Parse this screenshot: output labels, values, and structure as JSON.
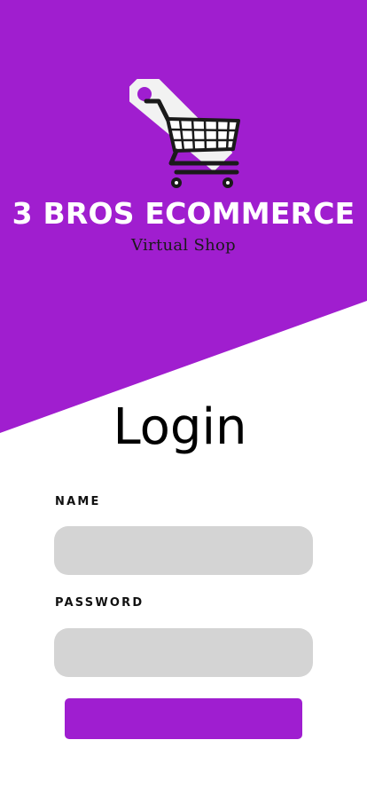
{
  "brand": {
    "title": "3 BROS ECOMMERCE",
    "subtitle": "Virtual Shop",
    "logo_icon": "shopping-cart-tag-icon"
  },
  "login": {
    "title": "Login",
    "name_label": "NAME",
    "name_value": "",
    "name_placeholder": "",
    "password_label": "PASSWORD",
    "password_value": "",
    "password_placeholder": "",
    "submit_label": ""
  },
  "colors": {
    "accent": "#a01ecf",
    "input_bg": "#d4d4d4",
    "background": "#ffffff"
  }
}
